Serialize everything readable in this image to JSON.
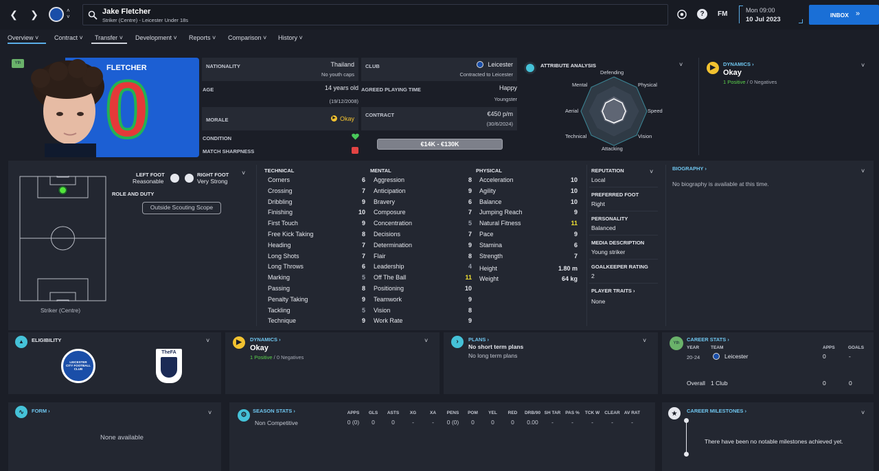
{
  "header": {
    "player_name": "Jake Fletcher",
    "player_sub": "Striker (Centre) - Leicester Under 18s",
    "fm_label": "FM",
    "date_day": "Mon 09:00",
    "date": "10 Jul 2023",
    "inbox_label": "INBOX"
  },
  "tabs": [
    "Overview",
    "Contract",
    "Transfer",
    "Development",
    "Reports",
    "Comparison",
    "History"
  ],
  "profile": {
    "badge": "Yth",
    "shirt_name": "FLETCHER",
    "shirt_number": "0",
    "nationality_label": "NATIONALITY",
    "nationality": "Thailand",
    "youth_caps": "No youth caps",
    "club_label": "CLUB",
    "club": "Leicester",
    "club_status": "Contracted to Leicester",
    "age_label": "AGE",
    "age": "14 years old",
    "dob": "(19/12/2008)",
    "apt_label": "AGREED PLAYING TIME",
    "apt": "Happy",
    "apt_sub": "Youngster",
    "morale_label": "MORALE",
    "morale": "Okay",
    "contract_label": "CONTRACT",
    "contract_wage": "€450 p/m",
    "contract_end": "(30/6/2024)",
    "condition_label": "CONDITION",
    "sharpness_label": "MATCH SHARPNESS",
    "value_range": "€14K - €130K"
  },
  "analysis": {
    "title": "ATTRIBUTE ANALYSIS",
    "labels": {
      "defending": "Defending",
      "physical": "Physical",
      "speed": "Speed",
      "vision": "Vision",
      "attacking": "Attacking",
      "technical": "Technical",
      "aerial": "Aerial",
      "mental": "Mental"
    }
  },
  "dynamics_top": {
    "title": "DYNAMICS",
    "value": "Okay",
    "positives": "1 Positive",
    "sep": "/",
    "negatives": "0 Negatives"
  },
  "position": {
    "left_foot_label": "LEFT FOOT",
    "left_foot": "Reasonable",
    "right_foot_label": "RIGHT FOOT",
    "right_foot": "Very Strong",
    "role_label": "ROLE AND DUTY",
    "scouting_btn": "Outside Scouting Scope",
    "position_name": "Striker (Centre)"
  },
  "attributes": {
    "technical_title": "TECHNICAL",
    "technical": [
      {
        "n": "Corners",
        "v": "6"
      },
      {
        "n": "Crossing",
        "v": "7"
      },
      {
        "n": "Dribbling",
        "v": "9"
      },
      {
        "n": "Finishing",
        "v": "10"
      },
      {
        "n": "First Touch",
        "v": "9"
      },
      {
        "n": "Free Kick Taking",
        "v": "8"
      },
      {
        "n": "Heading",
        "v": "7"
      },
      {
        "n": "Long Shots",
        "v": "7"
      },
      {
        "n": "Long Throws",
        "v": "6"
      },
      {
        "n": "Marking",
        "v": "5"
      },
      {
        "n": "Passing",
        "v": "8"
      },
      {
        "n": "Penalty Taking",
        "v": "9"
      },
      {
        "n": "Tackling",
        "v": "5"
      },
      {
        "n": "Technique",
        "v": "9"
      }
    ],
    "mental_title": "MENTAL",
    "mental": [
      {
        "n": "Aggression",
        "v": "8"
      },
      {
        "n": "Anticipation",
        "v": "9"
      },
      {
        "n": "Bravery",
        "v": "6"
      },
      {
        "n": "Composure",
        "v": "7"
      },
      {
        "n": "Concentration",
        "v": "5"
      },
      {
        "n": "Decisions",
        "v": "7"
      },
      {
        "n": "Determination",
        "v": "9"
      },
      {
        "n": "Flair",
        "v": "8"
      },
      {
        "n": "Leadership",
        "v": "4"
      },
      {
        "n": "Off The Ball",
        "v": "11"
      },
      {
        "n": "Positioning",
        "v": "10"
      },
      {
        "n": "Teamwork",
        "v": "9"
      },
      {
        "n": "Vision",
        "v": "8"
      },
      {
        "n": "Work Rate",
        "v": "9"
      }
    ],
    "physical_title": "PHYSICAL",
    "physical": [
      {
        "n": "Acceleration",
        "v": "10"
      },
      {
        "n": "Agility",
        "v": "10"
      },
      {
        "n": "Balance",
        "v": "10"
      },
      {
        "n": "Jumping Reach",
        "v": "9"
      },
      {
        "n": "Natural Fitness",
        "v": "11"
      },
      {
        "n": "Pace",
        "v": "9"
      },
      {
        "n": "Stamina",
        "v": "6"
      },
      {
        "n": "Strength",
        "v": "7"
      }
    ],
    "height_label": "Height",
    "height": "1.80 m",
    "weight_label": "Weight",
    "weight": "64 kg"
  },
  "info": {
    "reputation_label": "REPUTATION",
    "reputation": "Local",
    "foot_label": "PREFERRED FOOT",
    "foot": "Right",
    "personality_label": "PERSONALITY",
    "personality": "Balanced",
    "media_label": "MEDIA DESCRIPTION",
    "media": "Young striker",
    "gk_label": "GOALKEEPER RATING",
    "gk": "2",
    "traits_label": "PLAYER TRAITS",
    "traits": "None"
  },
  "biography": {
    "title": "BIOGRAPHY",
    "text": "No biography is available at this time."
  },
  "eligibility": {
    "title": "ELIGIBILITY",
    "lcfc_text": "LEICESTER CITY FOOTBALL CLUB",
    "fa_text": "TheFA"
  },
  "dynamics_mid": {
    "title": "DYNAMICS",
    "value": "Okay",
    "positives": "1 Positive",
    "sep": "/",
    "negatives": "0 Negatives"
  },
  "plans": {
    "title": "PLANS",
    "short": "No short term plans",
    "long": "No long term plans"
  },
  "career": {
    "title": "CAREER STATS",
    "badge": "Yth",
    "year_h": "YEAR",
    "team_h": "TEAM",
    "apps_h": "APPS",
    "goals_h": "GOALS",
    "year": "20-24",
    "team": "Leicester",
    "apps": "0",
    "goals": "-",
    "overall": "Overall",
    "clubs": "1 Club",
    "total_apps": "0",
    "total_goals": "0"
  },
  "form": {
    "title": "FORM",
    "text": "None available"
  },
  "season": {
    "title": "SEASON STATS",
    "headers": [
      "APPS",
      "GLS",
      "ASTS",
      "XG",
      "XA",
      "PENS",
      "POM",
      "YEL",
      "RED",
      "DRB/90",
      "SH TAR",
      "PAS %",
      "TCK W",
      "CLEAR",
      "AV RAT"
    ],
    "row_label": "Non Competitive",
    "values": [
      "0 (0)",
      "0",
      "0",
      "-",
      "-",
      "0 (0)",
      "0",
      "0",
      "0",
      "0.00",
      "-",
      "-",
      "-",
      "-",
      "-"
    ]
  },
  "milestones": {
    "title": "CAREER MILESTONES",
    "text": "There have been no notable milestones achieved yet."
  }
}
